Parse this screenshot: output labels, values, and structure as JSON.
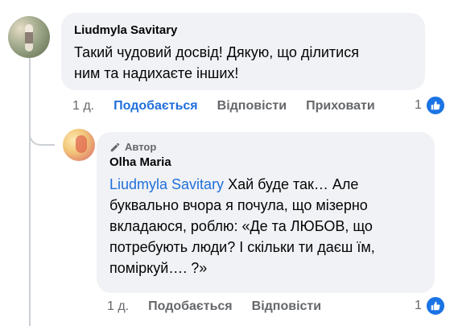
{
  "colors": {
    "bubble": "#f0f2f5",
    "link": "#216fdb",
    "secondary_text": "#65676b",
    "like_blue": "#1b74e4"
  },
  "comment": {
    "author": "Liudmyla Savitary",
    "text_line1": "Такий чудовий досвід! Дякую, що ділитися",
    "text_line2": "ним та надихаєте інших!",
    "time": "1 д.",
    "actions": {
      "like": "Подобається",
      "reply": "Відповісти",
      "hide": "Приховати"
    },
    "reaction_count": "1",
    "reaction_icon": "thumbs-up-icon"
  },
  "reply": {
    "badge": "Автор",
    "badge_icon": "pen-icon",
    "author": "Olha Maria",
    "mention": "Liudmyla Savitary",
    "text_line1_rest": " Хай буде так… Але",
    "text_line2": "буквально вчора я почула, що мізерно",
    "text_line3": "вкладаюся, роблю: «Де та ЛЮБОВ, що",
    "text_line4": "потребують люди? І скільки ти даєш їм,",
    "text_line5": "поміркуй…. ?»",
    "time": "1 д.",
    "actions": {
      "like": "Подобається",
      "reply": "Відповісти"
    },
    "reaction_count": "1",
    "reaction_icon": "thumbs-up-icon"
  }
}
